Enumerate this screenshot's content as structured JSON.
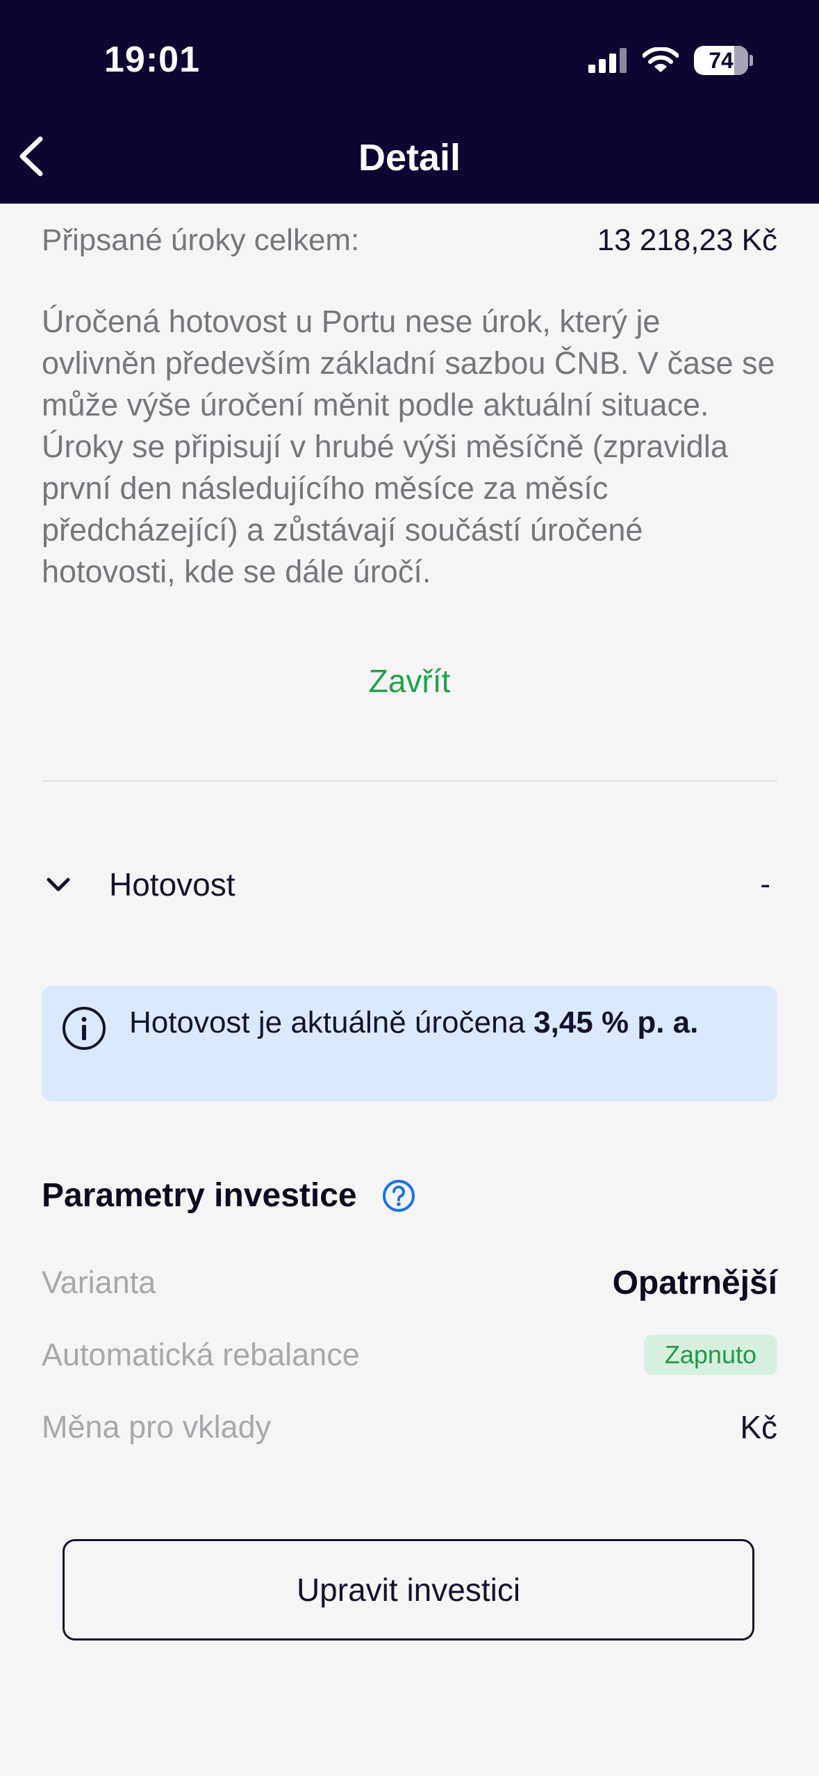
{
  "status_bar": {
    "time": "19:01",
    "battery": "74"
  },
  "nav": {
    "title": "Detail",
    "back_icon": "chevron-left-icon"
  },
  "interest": {
    "label": "Připsané úroky celkem:",
    "value": "13 218,23 Kč",
    "description": "Úročená hotovost u Portu nese úrok, který je ovlivněn především základní sazbou ČNB. V čase se může výše úročení měnit podle aktuální situace. Úroky se připisují v hrubé výši měsíčně (zpravidla první den následujícího měsíce za měsíc předcházející) a zůstávají součástí úročené hotovosti, kde se dále úročí.",
    "close_label": "Zavřít"
  },
  "cash": {
    "label": "Hotovost",
    "value": "-"
  },
  "info_box": {
    "text": "Hotovost je aktuálně úročena ",
    "highlight": "3,45 % p. a."
  },
  "parameters": {
    "title": "Parametry investice",
    "variant_label": "Varianta",
    "variant_value": "Opatrnější",
    "rebalance_label": "Automatická rebalance",
    "rebalance_value": "Zapnuto",
    "currency_label": "Měna pro vklady",
    "currency_value": "Kč"
  },
  "edit_button": {
    "label": "Upravit investici"
  },
  "colors": {
    "header_bg": "#0f0532",
    "accent_green": "#1fa34a",
    "info_bg": "#dbe9ff",
    "help_blue": "#1a73e8"
  }
}
